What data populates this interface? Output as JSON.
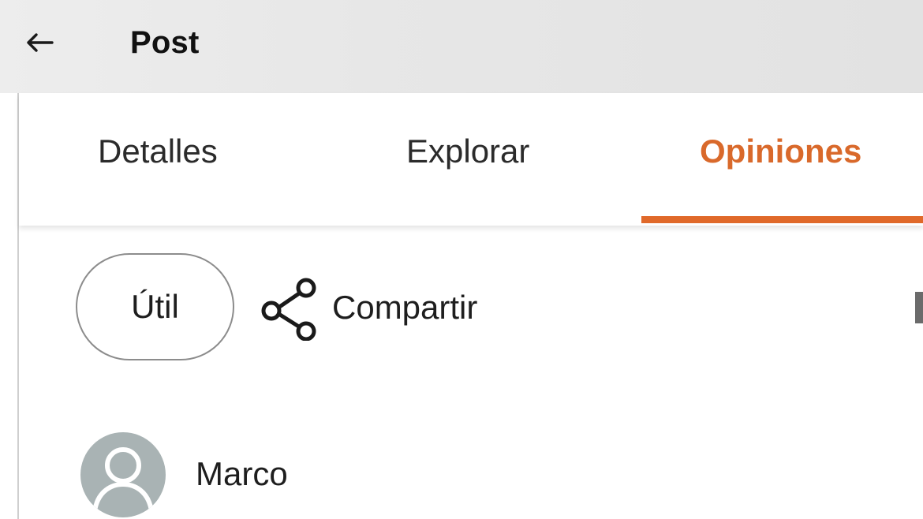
{
  "header": {
    "title": "Post",
    "back_icon": "arrow-left-icon"
  },
  "tabs": [
    {
      "label": "Detalles",
      "active": false
    },
    {
      "label": "Explorar",
      "active": false
    },
    {
      "label": "Opiniones",
      "active": true
    }
  ],
  "actions": {
    "useful_label": "Útil",
    "share_label": "Compartir",
    "share_icon": "share-icon"
  },
  "review": {
    "author": "Marco",
    "avatar_icon": "user-avatar-icon"
  },
  "colors": {
    "accent": "#e0692a",
    "active_tab_text": "#d9692b",
    "header_bg": "#e7e7e7",
    "avatar_bg": "#a9b3b4"
  }
}
